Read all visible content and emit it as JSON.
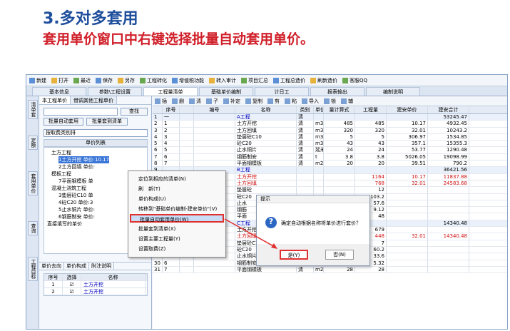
{
  "title": "3.多对多套用",
  "subtitle": "套用单价窗口中右键选择批量自动套用单价。",
  "toolbar": [
    "新建",
    "打开",
    "最近",
    "保存",
    "另存",
    "工程转化",
    "增值税功能",
    "转入审计",
    "项目汇总",
    "工程总造价",
    "刷新造价",
    "客服QQ"
  ],
  "tabs": [
    "基本信息",
    "参数\\工程设置",
    "工程量清单",
    "基础单价编制",
    "计日工",
    "报表输出",
    "编制说明"
  ],
  "vtabs": [
    "清单套",
    "定额",
    "套用单价",
    "查询",
    "工程目标"
  ],
  "left": {
    "tabs": [
      "本工程单价",
      "借调其他工程单价"
    ],
    "search_btn": "查找",
    "btn_auto": "批量自动套用",
    "btn_list": "批量套到清单",
    "select": "按取费类别排",
    "list_header": "单价列表",
    "tree": [
      "土方工程",
      "1土方开挖 单价:10.17",
      "2土方回填 单价:",
      "模板工程",
      "7平面钢模板 单",
      "混凝土浇筑工程",
      "3垫层砼C10 单",
      "4砼C20 单价:3",
      "5止水铜片 单价:",
      "6钢筋制安 单价:",
      "直接填写的单价"
    ],
    "bottom_tabs": [
      "单价去向",
      "单价构成",
      "附注说明"
    ],
    "mini_header": [
      "序号",
      "选择",
      "名称"
    ],
    "mini_rows": [
      [
        "1",
        "土方开挖"
      ],
      [
        "2",
        "土方开挖"
      ]
    ]
  },
  "right_toolbar": [
    "插",
    "删",
    "清",
    "子",
    "补定",
    "复制",
    "剪",
    "粘",
    "导入",
    "锁",
    "辅"
  ],
  "grid": {
    "headers": [
      "",
      "序号",
      "",
      "编号",
      "名称",
      "类别",
      "单位",
      "量计算式",
      "工程量",
      "建安单价",
      "建安合计"
    ],
    "rows": [
      [
        "1",
        "一",
        "",
        "",
        "A工程",
        "清",
        "",
        "",
        "",
        "",
        "53245.47"
      ],
      [
        "2",
        "1",
        "",
        "",
        "土方开挖",
        "清",
        "m3",
        "485",
        "485",
        "10.17",
        "4932.45"
      ],
      [
        "3",
        "2",
        "",
        "",
        "土方回填",
        "清",
        "m3",
        "320",
        "320",
        "32.01",
        "10243.2"
      ],
      [
        "4",
        "3",
        "",
        "",
        "垫层砼C10",
        "清",
        "m3",
        "5",
        "5",
        "306.97",
        "1534.85"
      ],
      [
        "5",
        "4",
        "",
        "",
        "砼C20",
        "清",
        "m3",
        "43",
        "43",
        "357.1",
        "15355.3"
      ],
      [
        "6",
        "5",
        "",
        "",
        "止水铜片",
        "清",
        "延米",
        "24",
        "24",
        "53.77",
        "1290.48"
      ],
      [
        "7",
        "6",
        "",
        "",
        "钢筋制安",
        "清",
        "t",
        "3.8",
        "3.8",
        "5026.05",
        "19098.99"
      ],
      [
        "8",
        "7",
        "",
        "",
        "平面钢模板",
        "清",
        "m2",
        "20",
        "20",
        "39.51",
        "790.2"
      ],
      [
        "9",
        "",
        "",
        "",
        "B工程",
        "",
        "",
        "",
        "",
        "",
        "36421.56"
      ],
      [
        "10",
        "",
        "",
        "",
        "土方开挖",
        "",
        "",
        "",
        "1164",
        "10.17",
        "11837.88"
      ],
      [
        "11",
        "",
        "",
        "",
        "土方回填",
        "",
        "",
        "",
        "768",
        "32.01",
        "24583.68"
      ],
      [
        "12",
        "",
        "",
        "",
        "垫层砼",
        "",
        "",
        "",
        "12",
        "",
        ""
      ],
      [
        "13",
        "",
        "",
        "",
        "砼C20",
        "",
        "",
        "",
        "103.2",
        "",
        ""
      ],
      [
        "14",
        "",
        "",
        "",
        "止水",
        "",
        "",
        "",
        "57.6",
        "",
        ""
      ],
      [
        "15",
        "",
        "",
        "",
        "钢筋",
        "",
        "",
        "",
        "9.12",
        "",
        ""
      ],
      [
        "16",
        "",
        "",
        "",
        "平面",
        "",
        "",
        "",
        "48",
        "",
        ""
      ],
      [
        "24",
        "二",
        "",
        "",
        "C工程",
        "",
        "",
        "",
        "",
        "",
        "14340.48"
      ],
      [
        "25",
        "1",
        "",
        "",
        "土方开挖",
        "",
        "",
        "",
        "679",
        "",
        ""
      ],
      [
        "26",
        "2",
        "",
        "",
        "土方回填",
        "清",
        "m3",
        "448",
        "448",
        "32.01",
        "14340.48"
      ],
      [
        "27",
        "3",
        "",
        "",
        "垫层砼C10",
        "清",
        "m3",
        "7",
        "7",
        "",
        ""
      ],
      [
        "28",
        "4",
        "",
        "",
        "砼C20",
        "清",
        "m3",
        "60.2",
        "60.2",
        "",
        ""
      ],
      [
        "29",
        "5",
        "",
        "",
        "止水铜片",
        "清",
        "延米",
        "33.6",
        "33.6",
        "",
        ""
      ],
      [
        "30",
        "6",
        "",
        "",
        "钢筋制安",
        "清",
        "t",
        "5.32",
        "5.32",
        "",
        ""
      ],
      [
        "31",
        "7",
        "",
        "",
        "平面钢模板",
        "清",
        "m2",
        "28",
        "28",
        "",
        ""
      ]
    ]
  },
  "context_menu": [
    "定位到相应的清单(N)",
    "刷　新(T)",
    "单价构成(U)",
    "转移到\"基础单价编制-建安单价\"(V)",
    "批量自动套用单价(W)",
    "批量套到清单(X)",
    "设置主要工程量(Y)",
    "设置取费(Z)"
  ],
  "dialog": {
    "title": "提示",
    "message": "确定自动根据名称将单价进行套价？",
    "yes": "是(Y)",
    "no": "否(N)"
  },
  "colors": {
    "title": "#1f4e9c",
    "subtitle": "#d0202a",
    "highlight": "#e03030"
  }
}
